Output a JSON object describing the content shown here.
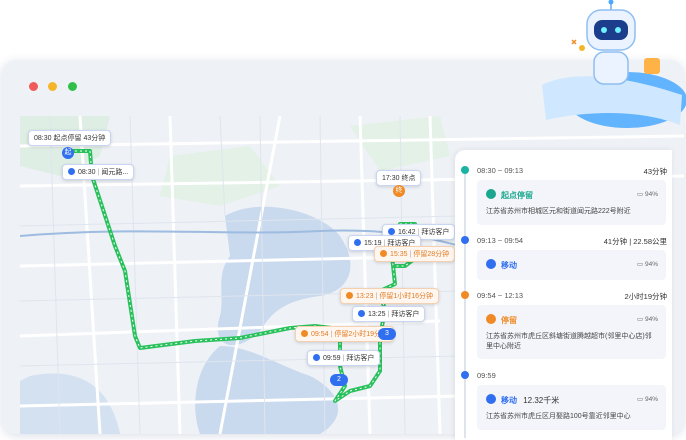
{
  "window": {
    "traffic_lights": [
      "#f05a5a",
      "#f5b52a",
      "#2fbf4a"
    ]
  },
  "map": {
    "start_label": {
      "time": "08:30",
      "text": "起点停留",
      "duration": "43分钟"
    },
    "end_label": {
      "time": "17:30",
      "text": "终点"
    },
    "markers": [
      {
        "time": "08:30",
        "text": "闻元路...",
        "style": "blue"
      },
      {
        "time": "16:42",
        "text": "拜访客户",
        "style": "blue"
      },
      {
        "time": "15:19",
        "text": "拜访客户",
        "style": "blue"
      },
      {
        "time": "15:35",
        "text": "停留28分钟",
        "style": "orange"
      },
      {
        "time": "13:23",
        "text": "停留1小时16分钟",
        "style": "orange"
      },
      {
        "time": "13:25",
        "text": "拜访客户",
        "style": "blue"
      },
      {
        "time": "09:54",
        "text": "停留2小时19分钟",
        "style": "orange"
      },
      {
        "time": "09:59",
        "text": "拜访客户",
        "style": "blue"
      }
    ],
    "pins": [
      "3",
      "2"
    ]
  },
  "panel": {
    "rows": [
      {
        "time_range": "08:30 ~ 09:13",
        "summary": "43分钟",
        "dot_color": "#19b3a3",
        "title": "起点停留",
        "title_color": "#19a88f",
        "icon": "location-pin-icon",
        "battery": "94%",
        "address": "江苏省苏州市相城区元和街道闻元路222号附近"
      },
      {
        "time_range": "09:13 ~ 09:54",
        "summary": "41分钟 | 22.58公里",
        "dot_color": "#2f6ff0",
        "title": "移动",
        "title_color": "#2f6ff0",
        "icon": "move-icon",
        "battery": "94%",
        "address": ""
      },
      {
        "time_range": "09:54 ~ 12:13",
        "summary": "2小时19分钟",
        "dot_color": "#f08a24",
        "title": "停留",
        "title_color": "#f08a24",
        "icon": "stay-icon",
        "battery": "94%",
        "address": "江苏省苏州市虎丘区斜塘街道腾越超市(邻里中心店)邻里中心附近"
      },
      {
        "time_range": "09:59",
        "summary": "",
        "dot_color": "#2f6ff0",
        "title": "移动",
        "distance": "12.32千米",
        "title_color": "#2f6ff0",
        "icon": "move-icon",
        "battery": "94%",
        "address": "江苏省苏州市虎丘区月娶路100号靠近邻里中心"
      }
    ]
  },
  "mascot": {
    "icon": "robot-mascot-icon"
  }
}
